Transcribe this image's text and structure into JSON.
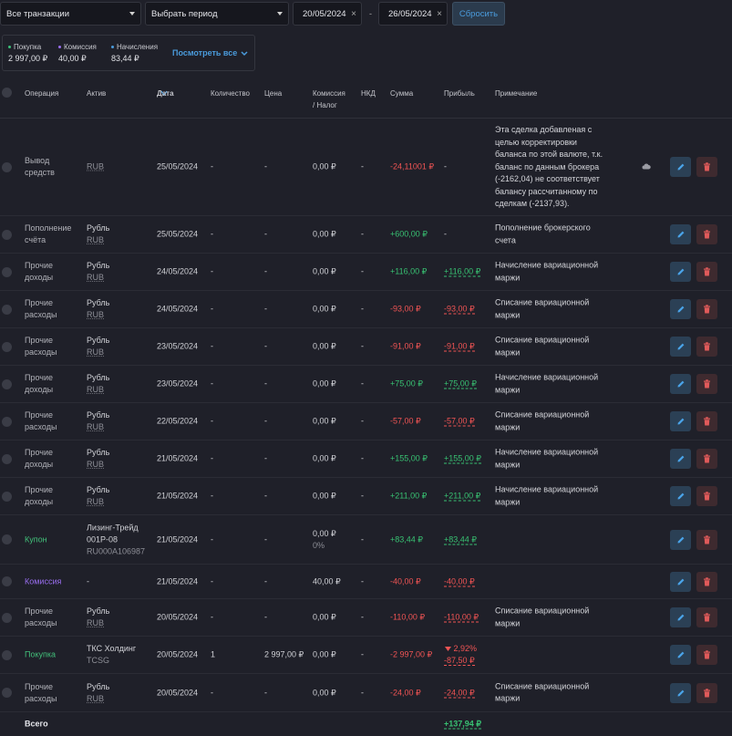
{
  "filters": {
    "type_select": "Все транзакции",
    "period_select": "Выбрать период",
    "date_from": "20/05/2024",
    "date_to": "26/05/2024",
    "dash": "-",
    "reset_label": "Сбросить",
    "clear_glyph": "×"
  },
  "summary": {
    "items": [
      {
        "label": "Покупка",
        "value": "2 997,00 ₽",
        "color": "#3cc17a"
      },
      {
        "label": "Комиссия",
        "value": "40,00 ₽",
        "color": "#9a6ef0"
      },
      {
        "label": "Начисления",
        "value": "83,44 ₽",
        "color": "#4a9bdc"
      }
    ],
    "see_all": "Посмотреть все"
  },
  "columns": [
    "Операция",
    "Актив",
    "Дата",
    "Количество",
    "Цена",
    "Комиссия",
    "/ Налог",
    "НКД",
    "Сумма",
    "Прибыль",
    "Примечание"
  ],
  "rows": [
    {
      "op1": "Вывод",
      "op2": "средств",
      "asset1": "",
      "asset2": "RUB",
      "date": "25/05/2024",
      "qty": "-",
      "price": "-",
      "fee": "0,00 ₽",
      "fee2": "",
      "nkd": "-",
      "sum": "-24,11001 ₽",
      "profit": "-",
      "profit2": "",
      "note1": "Эта сделка добавленая с",
      "note2": "целью корректировки",
      "note3": "баланса по этой валюте, т.к.",
      "note4": "баланс по данным брокера",
      "note5": "(-2162,04) не соответствует",
      "note6": "балансу рассчитанному по",
      "note7": "сделкам (-2137,93)."
    },
    {
      "op1": "Пополнение",
      "op2": "счёта",
      "asset1": "Рубль",
      "asset2": "RUB",
      "date": "25/05/2024",
      "qty": "-",
      "price": "-",
      "fee": "0,00 ₽",
      "fee2": "",
      "nkd": "-",
      "sum": "+600,00 ₽",
      "profit": "-",
      "profit2": "",
      "note1": "Пополнение брокерского",
      "note2": "счета"
    },
    {
      "op1": "Прочие",
      "op2": "доходы",
      "asset1": "Рубль",
      "asset2": "RUB",
      "date": "24/05/2024",
      "qty": "-",
      "price": "-",
      "fee": "0,00 ₽",
      "fee2": "",
      "nkd": "-",
      "sum": "+116,00 ₽",
      "profit": "+116,00 ₽",
      "profit2": "",
      "note1": "Начисление вариационной",
      "note2": "маржи"
    },
    {
      "op1": "Прочие",
      "op2": "расходы",
      "asset1": "Рубль",
      "asset2": "RUB",
      "date": "24/05/2024",
      "qty": "-",
      "price": "-",
      "fee": "0,00 ₽",
      "fee2": "",
      "nkd": "-",
      "sum": "-93,00 ₽",
      "profit": "-93,00 ₽",
      "profit2": "",
      "note1": "Списание вариационной",
      "note2": "маржи"
    },
    {
      "op1": "Прочие",
      "op2": "расходы",
      "asset1": "Рубль",
      "asset2": "RUB",
      "date": "23/05/2024",
      "qty": "-",
      "price": "-",
      "fee": "0,00 ₽",
      "fee2": "",
      "nkd": "-",
      "sum": "-91,00 ₽",
      "profit": "-91,00 ₽",
      "profit2": "",
      "note1": "Списание вариационной",
      "note2": "маржи"
    },
    {
      "op1": "Прочие",
      "op2": "доходы",
      "asset1": "Рубль",
      "asset2": "RUB",
      "date": "23/05/2024",
      "qty": "-",
      "price": "-",
      "fee": "0,00 ₽",
      "fee2": "",
      "nkd": "-",
      "sum": "+75,00 ₽",
      "profit": "+75,00 ₽",
      "profit2": "",
      "note1": "Начисление вариационной",
      "note2": "маржи"
    },
    {
      "op1": "Прочие",
      "op2": "расходы",
      "asset1": "Рубль",
      "asset2": "RUB",
      "date": "22/05/2024",
      "qty": "-",
      "price": "-",
      "fee": "0,00 ₽",
      "fee2": "",
      "nkd": "-",
      "sum": "-57,00 ₽",
      "profit": "-57,00 ₽",
      "profit2": "",
      "note1": "Списание вариационной",
      "note2": "маржи"
    },
    {
      "op1": "Прочие",
      "op2": "доходы",
      "asset1": "Рубль",
      "asset2": "RUB",
      "date": "21/05/2024",
      "qty": "-",
      "price": "-",
      "fee": "0,00 ₽",
      "fee2": "",
      "nkd": "-",
      "sum": "+155,00 ₽",
      "profit": "+155,00 ₽",
      "profit2": "",
      "note1": "Начисление вариационной",
      "note2": "маржи"
    },
    {
      "op1": "Прочие",
      "op2": "доходы",
      "asset1": "Рубль",
      "asset2": "RUB",
      "date": "21/05/2024",
      "qty": "-",
      "price": "-",
      "fee": "0,00 ₽",
      "fee2": "",
      "nkd": "-",
      "sum": "+211,00 ₽",
      "profit": "+211,00 ₽",
      "profit2": "",
      "note1": "Начисление вариационной",
      "note2": "маржи"
    },
    {
      "op1": "Купон",
      "op2": "",
      "asset1": "Лизинг-Трейд",
      "asset1b": "001P-08",
      "asset2": "RU000A106987",
      "date": "21/05/2024",
      "qty": "-",
      "price": "-",
      "fee": "0,00 ₽",
      "fee2": "0%",
      "nkd": "-",
      "sum": "+83,44 ₽",
      "profit": "+83,44 ₽",
      "profit2": "",
      "note1": "",
      "note2": ""
    },
    {
      "op1": "Комиссия",
      "op2": "",
      "asset1": "-",
      "asset2": "",
      "date": "21/05/2024",
      "qty": "-",
      "price": "-",
      "fee": "40,00 ₽",
      "fee2": "",
      "nkd": "-",
      "sum": "-40,00 ₽",
      "profit": "-40,00 ₽",
      "profit2": "",
      "note1": "",
      "note2": ""
    },
    {
      "op1": "Прочие",
      "op2": "расходы",
      "asset1": "Рубль",
      "asset2": "RUB",
      "date": "20/05/2024",
      "qty": "-",
      "price": "-",
      "fee": "0,00 ₽",
      "fee2": "",
      "nkd": "-",
      "sum": "-110,00 ₽",
      "profit": "-110,00 ₽",
      "profit2": "",
      "note1": "Списание вариационной",
      "note2": "маржи"
    },
    {
      "op1": "Покупка",
      "op2": "",
      "asset1": "ТКС Холдинг",
      "asset2": "TCSG",
      "date": "20/05/2024",
      "qty": "1",
      "price": "2 997,00 ₽",
      "fee": "0,00 ₽",
      "fee2": "",
      "nkd": "-",
      "sum": "-2 997,00 ₽",
      "profit": "2,92%",
      "profit2": "-87,50 ₽",
      "note1": "",
      "note2": ""
    },
    {
      "op1": "Прочие",
      "op2": "расходы",
      "asset1": "Рубль",
      "asset2": "RUB",
      "date": "20/05/2024",
      "qty": "-",
      "price": "-",
      "fee": "0,00 ₽",
      "fee2": "",
      "nkd": "-",
      "sum": "-24,00 ₽",
      "profit": "-24,00 ₽",
      "profit2": "",
      "note1": "Списание вариационной",
      "note2": "маржи"
    }
  ],
  "total": {
    "label": "Всего",
    "value": "+137,94 ₽"
  }
}
